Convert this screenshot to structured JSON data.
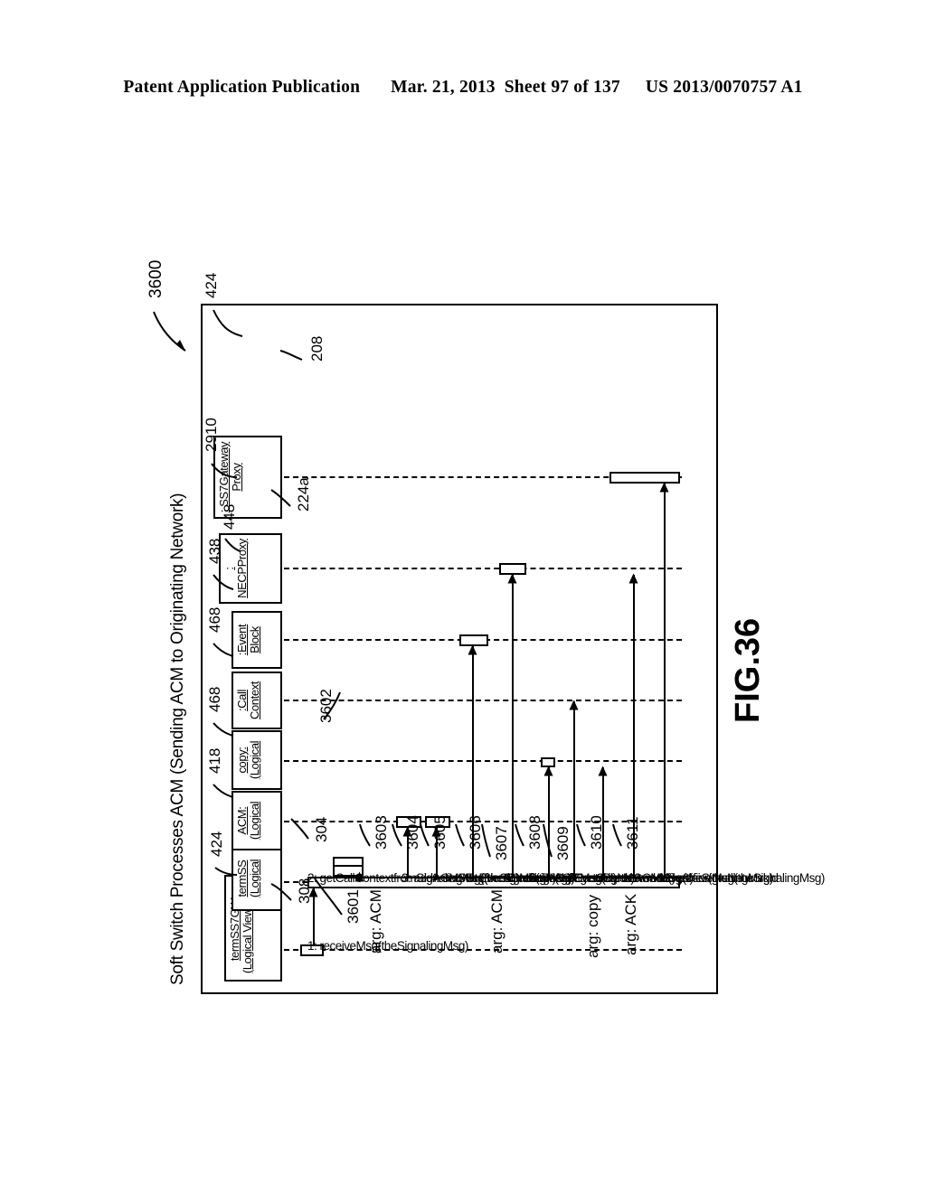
{
  "page_header": {
    "publication": "Patent Application Publication",
    "date": "Mar. 21, 2013",
    "sheet": "Sheet 97 of 137",
    "patent_number": "US 2013/0070757 A1"
  },
  "figure": {
    "caption": "FIG.36",
    "diagram_number": "3600",
    "title": "Soft Switch Processes ACM (Sending ACM to Originating Network)",
    "type": "uml-sequence-diagram",
    "rotation": "90-ccw"
  },
  "lifelines": [
    {
      "id": "termss7gw",
      "line1": "termSS7GW:",
      "line2": "(Logical View::(LV)",
      "ref": "424",
      "ref_inner": "308"
    },
    {
      "id": "termss",
      "line1": "termSS",
      "line2": "(Logical",
      "ref": "418",
      "ref_inner": ""
    },
    {
      "id": "acm",
      "line1": "ACM:",
      "line2": "(Logical",
      "ref": "468",
      "ref_inner": ""
    },
    {
      "id": "copy",
      "line1": "copy:",
      "line2": "(Logical",
      "ref": "468",
      "ref_inner": ""
    },
    {
      "id": "callcontext",
      "line1": ":Call",
      "line2": "Context",
      "ref": "438",
      "ref_inner": ""
    },
    {
      "id": "eventblock",
      "line1": ":Event",
      "line2": "Block",
      "ref": "448",
      "ref_inner": ""
    },
    {
      "id": "necpproxy",
      "line1": ":",
      "line2": "NECPProxy",
      "ref": "2910",
      "ref_inner": "224a"
    },
    {
      "id": "ss7gateway",
      "line1": ": SS7Gateway",
      "line2": "Proxy",
      "ref": "424",
      "ref_inner": "208"
    }
  ],
  "messages": [
    {
      "num": "1:",
      "label": "receiveMsg(theSignalingMsg)",
      "ref": "304",
      "arg": "ACM"
    },
    {
      "num": "2:",
      "label": "getCallContextfromSignalingMsg(theSignalingMsg)",
      "ref": "3602",
      "arg": ""
    },
    {
      "num": "3:",
      "label": "addACMMsg(theSignalingMsg)",
      "ref": "3603",
      "arg": ""
    },
    {
      "num": "4:",
      "label": "setState(theACMSent)",
      "ref": "3604",
      "arg": ""
    },
    {
      "num": "5:",
      "label": "EventBlock(theCallContext)",
      "ref": "3605",
      "arg": ""
    },
    {
      "num": "6:",
      "label": "receive(theEventBlock)",
      "ref": "3606",
      "arg": ""
    },
    {
      "num": "7:",
      "label": "ACMMsg(const ACMMsg&)",
      "ref": "3607",
      "arg": "ACM"
    },
    {
      "num": "8:",
      "label": "getOrigNetworkId()",
      "ref": "3608",
      "arg": ""
    },
    {
      "num": "9:",
      "label": "setNetworkIdentifier(theNetworkId",
      "ref": "3609",
      "arg": ""
    },
    {
      "num": "10:",
      "label": "receive(theSignalingMsg)",
      "ref": "3610",
      "arg": "copy"
    },
    {
      "num": "11:",
      "label": "receiveMsg(theSignalingMsg)",
      "ref": "3611",
      "arg": "ACK"
    }
  ],
  "extra_refs": {
    "diagram_pointer": "3600",
    "first_activation": "3601",
    "arg_prefix": "arg:"
  },
  "colors": {
    "ink": "#000000",
    "paper": "#ffffff"
  }
}
